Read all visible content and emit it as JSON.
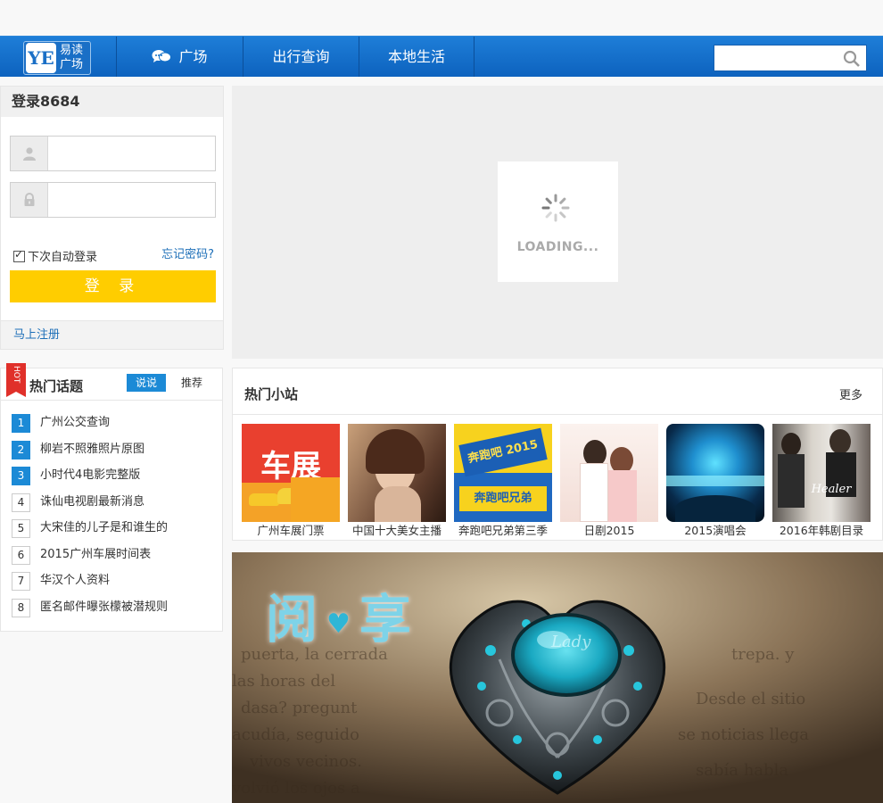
{
  "nav": {
    "logo_mark": "YE",
    "logo_line1": "易读",
    "logo_line2": "广场",
    "items": [
      {
        "label": "广场"
      },
      {
        "label": "出行查询"
      },
      {
        "label": "本地生活"
      }
    ],
    "search_placeholder": ""
  },
  "login": {
    "title": "登录8684",
    "username_placeholder": "",
    "password_placeholder": "",
    "remember_label": "下次自动登录",
    "forgot_label": "忘记密码?",
    "submit_label": "登 录",
    "register_label": "马上注册"
  },
  "topics": {
    "badge": "HOT",
    "title": "热门话题",
    "tab_active": "说说",
    "tab_other": "推荐",
    "items": [
      {
        "num": "1",
        "text": "广州公交查询"
      },
      {
        "num": "2",
        "text": "柳岩不照雅照片原图"
      },
      {
        "num": "3",
        "text": "小时代4电影完整版"
      },
      {
        "num": "4",
        "text": "诛仙电视剧最新消息"
      },
      {
        "num": "5",
        "text": "大宋佳的儿子是和谁生的"
      },
      {
        "num": "6",
        "text": "2015广州车展时间表"
      },
      {
        "num": "7",
        "text": "华汉个人资料"
      },
      {
        "num": "8",
        "text": "匿名邮件曝张檬被潜规则"
      }
    ]
  },
  "banner": {
    "loading_text": "LOADING..."
  },
  "sites": {
    "title": "热门小站",
    "more": "更多",
    "items": [
      {
        "caption": "广州车展门票",
        "thumb_text": "车展"
      },
      {
        "caption": "中国十大美女主播",
        "thumb_text": ""
      },
      {
        "caption": "奔跑吧兄弟第三季",
        "thumb_text": "奔跑吧 2015",
        "thumb_text2": "奔跑吧兄弟"
      },
      {
        "caption": "日剧2015",
        "thumb_text": ""
      },
      {
        "caption": "2015演唱会",
        "thumb_text": ""
      },
      {
        "caption": "2016年韩剧目录",
        "thumb_text": "Healer"
      }
    ]
  },
  "feature": {
    "title": "阅享",
    "title_a": "阅",
    "title_b": "享",
    "watermark": "Lady"
  }
}
